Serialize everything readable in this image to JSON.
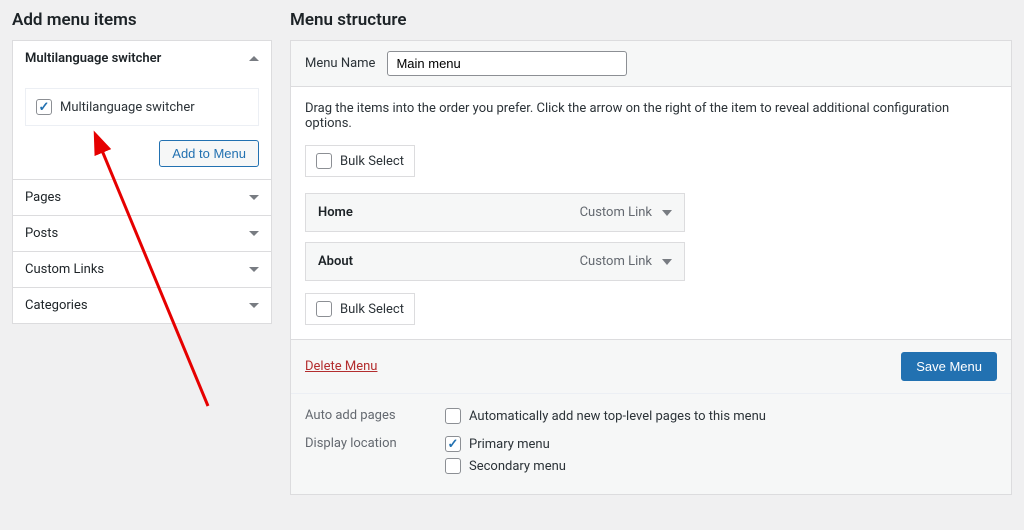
{
  "left": {
    "heading": "Add menu items",
    "sections": {
      "multilang": {
        "title": "Multilanguage switcher",
        "checkbox_label": "Multilanguage switcher",
        "checked": true,
        "add_button": "Add to Menu"
      },
      "collapsed": [
        {
          "title": "Pages"
        },
        {
          "title": "Posts"
        },
        {
          "title": "Custom Links"
        },
        {
          "title": "Categories"
        }
      ]
    }
  },
  "right": {
    "heading": "Menu structure",
    "menu_name_label": "Menu Name",
    "menu_name_value": "Main menu",
    "instructions": "Drag the items into the order you prefer. Click the arrow on the right of the item to reveal additional configuration options.",
    "bulk_select": "Bulk Select",
    "items": [
      {
        "title": "Home",
        "type": "Custom Link"
      },
      {
        "title": "About",
        "type": "Custom Link"
      }
    ],
    "delete_label": "Delete Menu",
    "save_label": "Save Menu",
    "settings": {
      "auto_add": {
        "label": "Auto add pages",
        "option": "Automatically add new top-level pages to this menu",
        "checked": false
      },
      "display_location": {
        "label": "Display location",
        "options": [
          {
            "label": "Primary menu",
            "checked": true
          },
          {
            "label": "Secondary menu",
            "checked": false
          }
        ]
      }
    }
  }
}
